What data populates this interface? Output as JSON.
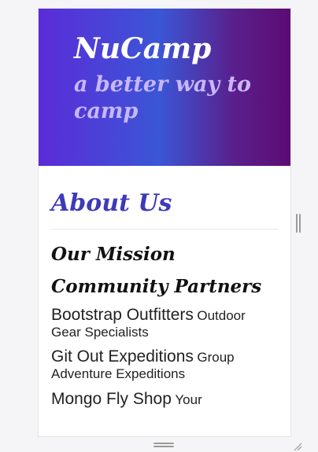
{
  "hero": {
    "brand": "NuCamp",
    "tagline": "a better way to camp"
  },
  "about": {
    "title": "About Us",
    "mission_title": "Our Mission",
    "partners_title": "Community Partners",
    "partners": [
      {
        "name": "Bootstrap Outfitters",
        "desc": "Outdoor Gear Specialists"
      },
      {
        "name": "Git Out Expeditions",
        "desc": "Group Adventure Expeditions"
      },
      {
        "name": "Mongo Fly Shop",
        "desc": "Your"
      }
    ]
  },
  "ui": {
    "handles": [
      "side-resize-handle-icon",
      "bottom-resize-handle-icon",
      "corner-resize-grip-icon"
    ]
  }
}
